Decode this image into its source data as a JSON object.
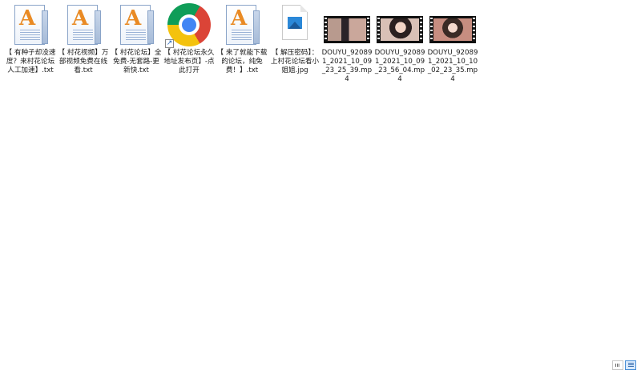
{
  "files": [
    {
      "name": "【 有种子却没速度？来村花论坛人工加速】.txt",
      "type": "txt-icon"
    },
    {
      "name": "【 村花视频】万部视频免费在线看.txt",
      "type": "txt-icon"
    },
    {
      "name": "【 村花论坛】全免费-无套路-更新快.txt",
      "type": "txt-icon"
    },
    {
      "name": "【 村花论坛永久地址发布页】-点此打开",
      "type": "chrome-shortcut-icon"
    },
    {
      "name": "【 来了就能下载的论坛，纯免费！】.txt",
      "type": "txt-icon"
    },
    {
      "name": "【 解压密码】：上村花论坛看小姐姐.jpg",
      "type": "image-file-icon"
    },
    {
      "name": "DOUYU_920891_2021_10_09_23_25_39.mp4",
      "type": "video-thumbnail"
    },
    {
      "name": "DOUYU_920891_2021_10_09_23_56_04.mp4",
      "type": "video-thumbnail"
    },
    {
      "name": "DOUYU_920891_2021_10_10_02_23_35.mp4",
      "type": "video-thumbnail"
    }
  ],
  "statusbar": {
    "details_view": "details-view-icon",
    "large_icons_view": "large-icons-view-icon"
  },
  "colors": {
    "txt_letter": "#e98a24",
    "image_blue": "#2b88d8",
    "active_view": "#4a8fd6"
  }
}
